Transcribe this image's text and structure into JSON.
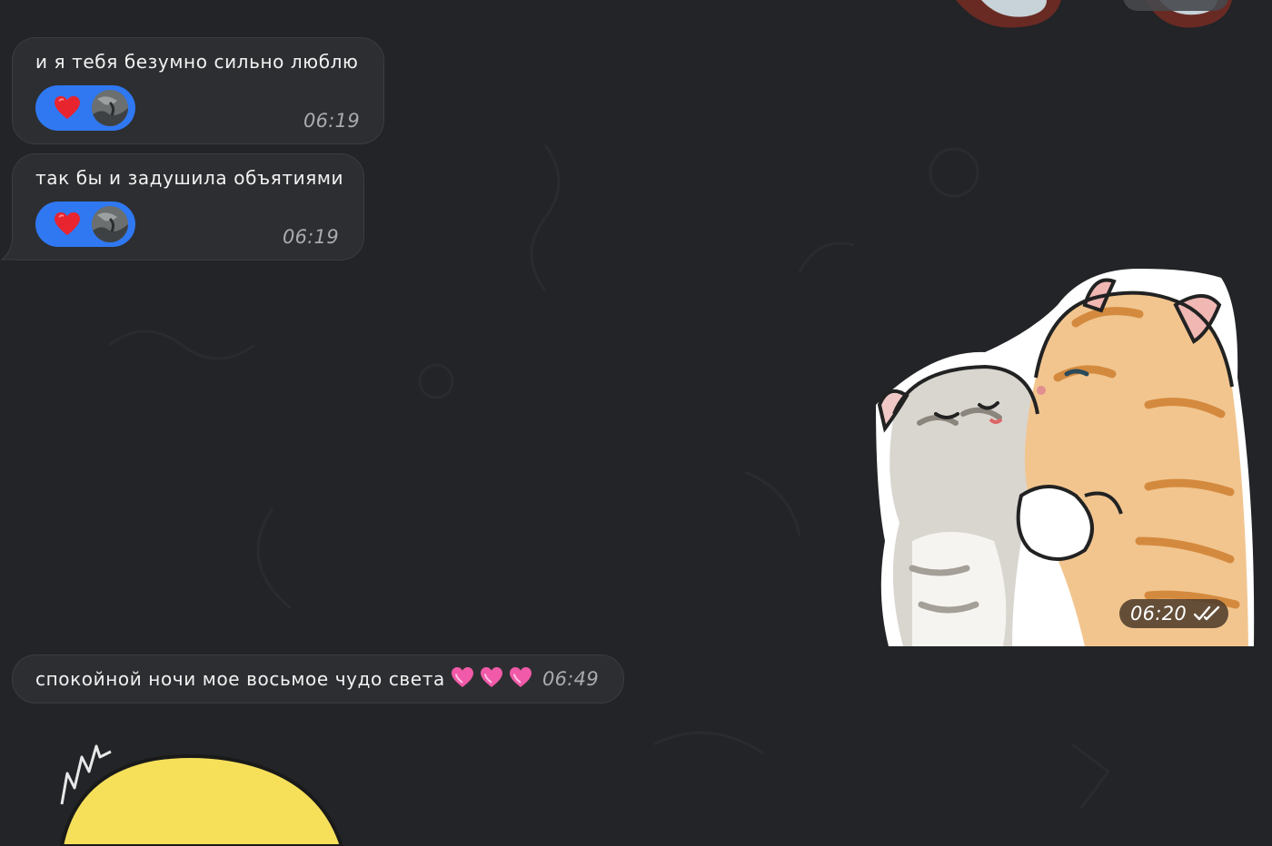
{
  "messages": [
    {
      "text": "и я тебя безумно сильно люблю",
      "time": "06:19",
      "reaction": "heart"
    },
    {
      "text": "так бы и задушила объятиями",
      "time": "06:19",
      "reaction": "heart"
    },
    {
      "text": "спокойной ночи мое восьмое чудо света",
      "time": "06:49",
      "emoji": "💗💗💗"
    }
  ],
  "sticker": {
    "time": "06:20",
    "status": "read"
  },
  "colors": {
    "background": "#222427",
    "bubble": "#2d2e31",
    "reaction": "#2f78f2",
    "time_text": "#a8abb0"
  }
}
